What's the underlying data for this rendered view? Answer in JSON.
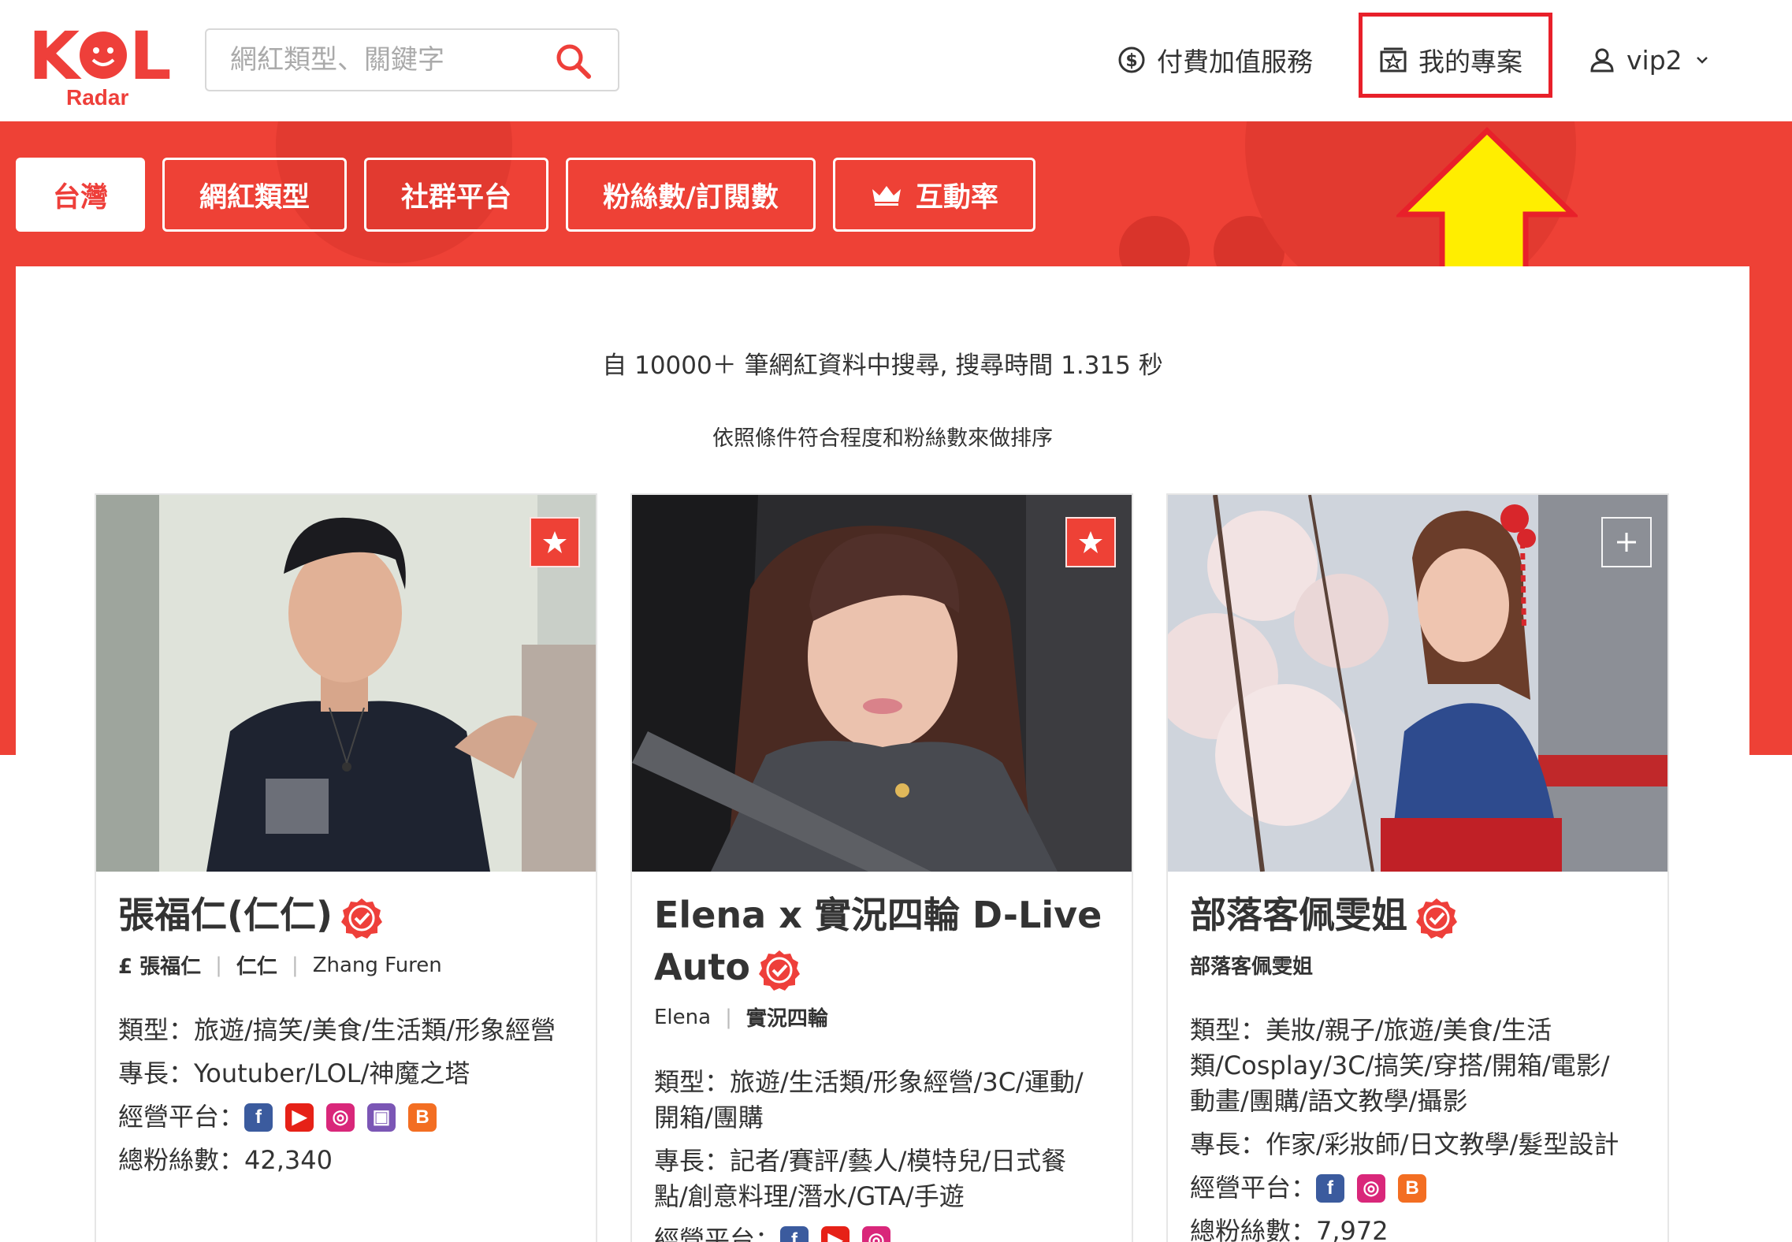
{
  "header": {
    "logo_text": "KOL",
    "logo_sub": "Radar",
    "search_placeholder": "網紅類型、關鍵字",
    "nav_paid": "付費加值服務",
    "nav_projects": "我的專案",
    "nav_user": "vip2"
  },
  "filters": [
    {
      "label": "台灣",
      "active": true
    },
    {
      "label": "網紅類型",
      "active": false
    },
    {
      "label": "社群平台",
      "active": false
    },
    {
      "label": "粉絲數/訂閱數",
      "active": false
    },
    {
      "label": "互動率",
      "active": false,
      "icon": "crown-icon"
    }
  ],
  "results": {
    "stats": "自 10000＋ 筆網紅資料中搜尋, 搜尋時間 1.315 秒",
    "sort_note": "依照條件符合程度和粉絲數來做排序"
  },
  "cards": [
    {
      "name": "張福仁(仁仁)",
      "aliases": [
        "£ 張福仁",
        "仁仁",
        "Zhang Furen"
      ],
      "type": "類型：旅遊/搞笑/美食/生活類/形象經營",
      "skills": "專長：Youtuber/LOL/神魔之塔",
      "platforms_label": "經營平台：",
      "platforms": [
        "facebook",
        "youtube",
        "instagram",
        "twitch",
        "blogger"
      ],
      "followers": "總粉絲數：42,340",
      "favorited": true
    },
    {
      "name_line1": "Elena x 實況四輪 D-Live",
      "name_line2": "Auto",
      "aliases": [
        "Elena",
        "實況四輪"
      ],
      "type_line1": "類型：旅遊/生活類/形象經營/3C/運動/",
      "type_line2": "開箱/團購",
      "skills_line1": "專長：記者/賽評/藝人/模特兒/日式餐",
      "skills_line2": "點/創意料理/潛水/GTA/手遊",
      "platforms_label": "經營平台：",
      "platforms": [
        "facebook",
        "youtube",
        "instagram"
      ],
      "favorited": true
    },
    {
      "name": "部落客佩雯姐",
      "aliases": [
        "部落客佩雯姐"
      ],
      "type_line1": "類型：美妝/親子/旅遊/美食/生活",
      "type_line2": "類/Cosplay/3C/搞笑/穿搭/開箱/電影/",
      "type_line3": "動畫/團購/語文教學/攝影",
      "skills": "專長：作家/彩妝師/日文教學/髮型設計",
      "platforms_label": "經營平台：",
      "platforms": [
        "facebook",
        "instagram",
        "blogger"
      ],
      "followers": "總粉絲數：7,972",
      "favorited": false
    }
  ],
  "colors": {
    "brand_red": "#ee4136",
    "highlight_red": "#e8202a",
    "arrow_yellow": "#ffee00"
  }
}
